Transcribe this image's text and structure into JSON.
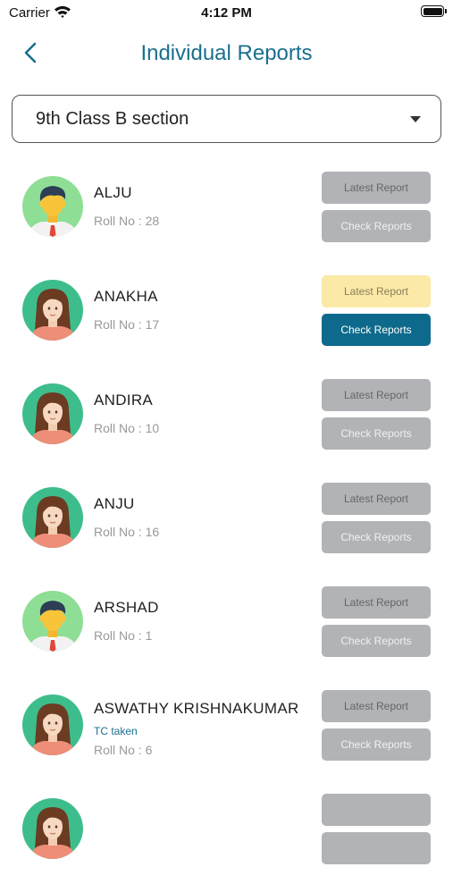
{
  "status_bar": {
    "carrier": "Carrier",
    "time": "4:12 PM"
  },
  "nav": {
    "title": "Individual Reports"
  },
  "section_select": {
    "value": "9th Class B section"
  },
  "students": [
    {
      "name": "ALJU",
      "roll": "Roll No : 28",
      "avatar": "boy",
      "latest_label": "Latest Report",
      "check_label": "Check Reports"
    },
    {
      "name": "ANAKHA",
      "roll": "Roll No : 17",
      "avatar": "girl",
      "latest_label": "Latest Report",
      "check_label": "Check Reports",
      "active": true
    },
    {
      "name": "ANDIRA",
      "roll": "Roll No : 10",
      "avatar": "girl",
      "latest_label": "Latest Report",
      "check_label": "Check Reports"
    },
    {
      "name": "ANJU",
      "roll": "Roll No : 16",
      "avatar": "girl",
      "latest_label": "Latest Report",
      "check_label": "Check Reports"
    },
    {
      "name": "ARSHAD",
      "roll": "Roll No : 1",
      "avatar": "boy",
      "latest_label": "Latest Report",
      "check_label": "Check Reports"
    },
    {
      "name": "ASWATHY KRISHNAKUMAR",
      "tag": "TC taken",
      "roll": "Roll No : 6",
      "avatar": "girl",
      "latest_label": "Latest Report",
      "check_label": "Check Reports"
    },
    {
      "name": "",
      "roll": "",
      "avatar": "girl",
      "latest_label": "",
      "check_label": ""
    }
  ],
  "colors": {
    "accent": "#1a6f8e",
    "button_inactive": "#b1b3b6",
    "button_latest_active": "#fbe9a7",
    "button_check_active": "#0e6a8c"
  },
  "icons": {
    "back": "chevron-left-icon",
    "dropdown": "caret-down-icon",
    "wifi": "wifi-icon",
    "battery": "battery-icon"
  }
}
